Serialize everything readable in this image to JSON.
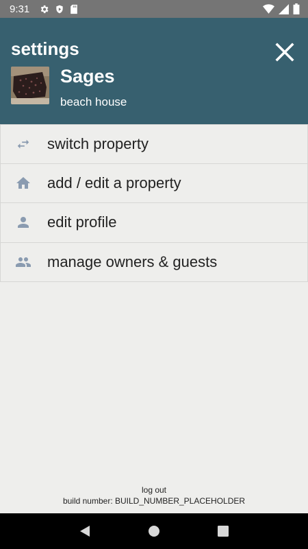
{
  "status_bar": {
    "time": "9:31",
    "left_icons": [
      "gear-icon",
      "shield-icon",
      "sd-card-icon"
    ],
    "right_icons": [
      "wifi-icon",
      "cell-signal-icon",
      "battery-icon"
    ]
  },
  "header": {
    "title": "settings",
    "property_name": "Sages",
    "property_subtitle": "beach house",
    "background_color": "#37606f"
  },
  "menu": {
    "items": [
      {
        "label": "switch property",
        "icon": "swap-arrows-icon"
      },
      {
        "label": "add / edit a property",
        "icon": "home-icon"
      },
      {
        "label": "edit profile",
        "icon": "person-icon"
      },
      {
        "label": "manage owners & guests",
        "icon": "people-icon"
      }
    ],
    "icon_color": "#8a9bb0"
  },
  "footer": {
    "logout_label": "log out",
    "build_number": "build number: BUILD_NUMBER_PLACEHOLDER"
  },
  "nav_bar": {
    "buttons": [
      "back-icon",
      "home-circle-icon",
      "recents-square-icon"
    ]
  }
}
